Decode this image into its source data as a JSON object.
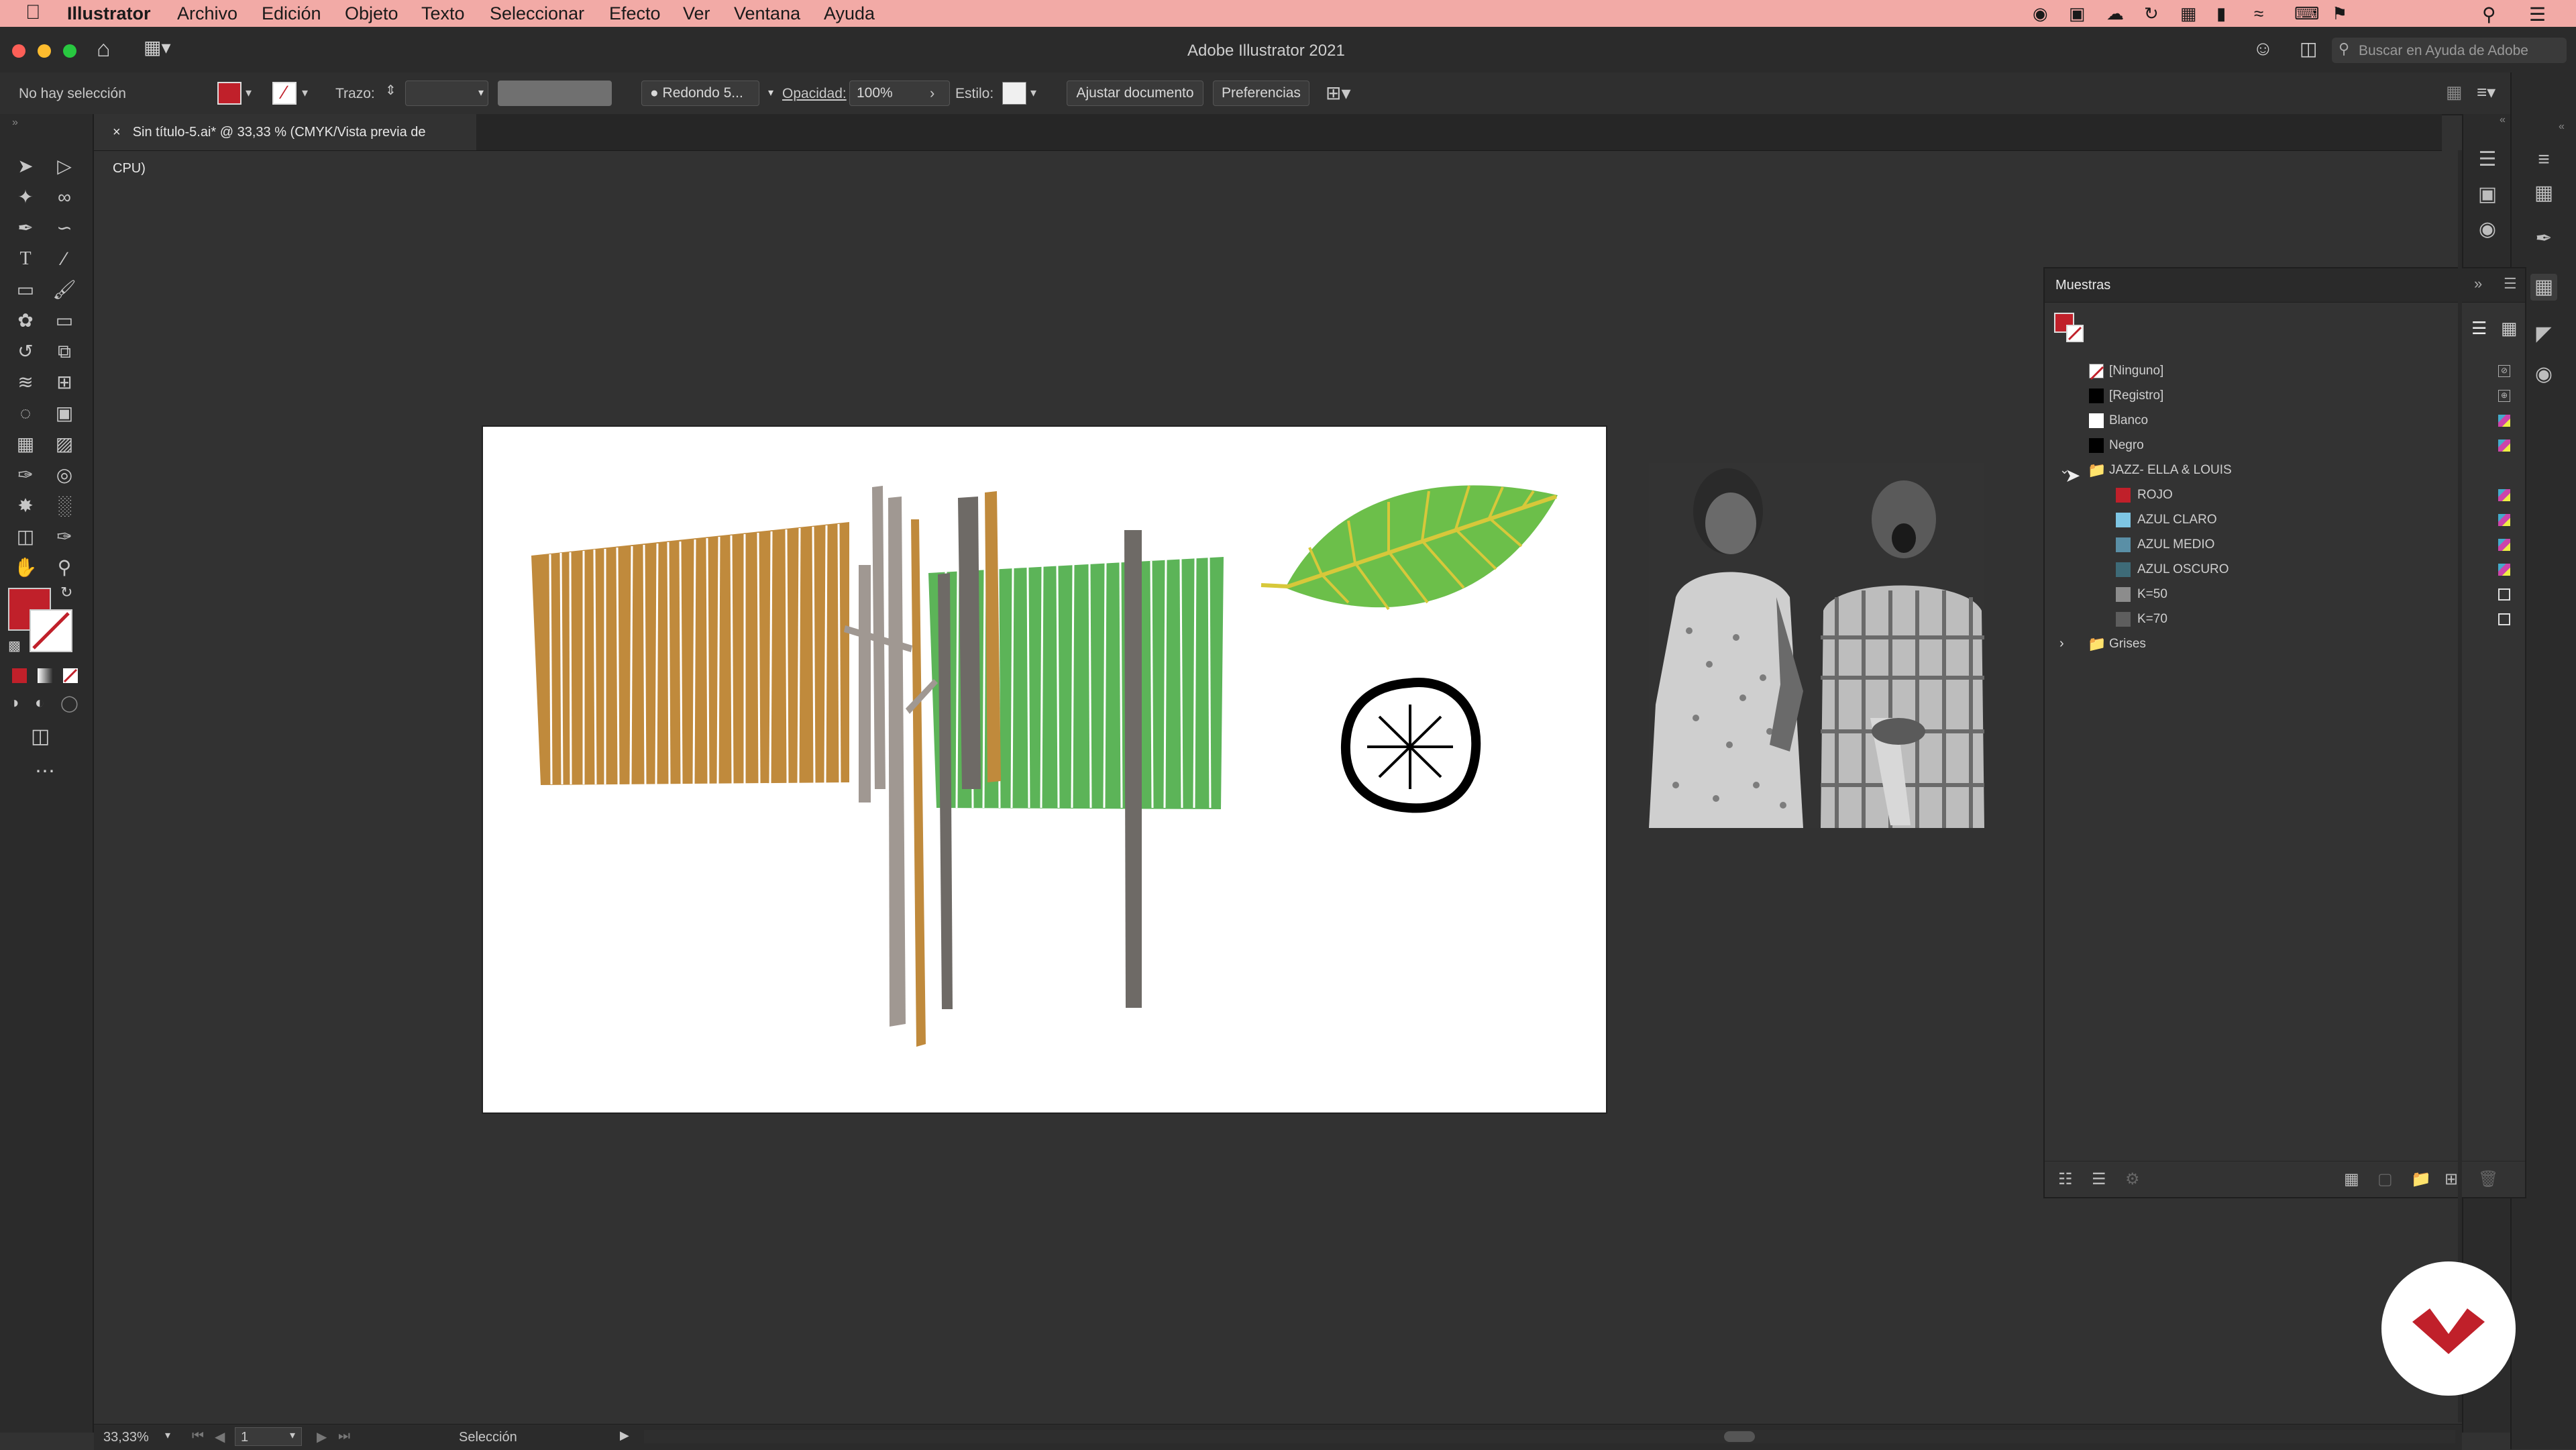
{
  "menubar": {
    "app_name": "Illustrator",
    "items": [
      "Archivo",
      "Edición",
      "Objeto",
      "Texto",
      "Seleccionar",
      "Efecto",
      "Ver",
      "Ventana",
      "Ayuda"
    ]
  },
  "titlebar": {
    "title": "Adobe Illustrator 2021",
    "search_placeholder": "Buscar en Ayuda de Adobe"
  },
  "controlbar": {
    "selection_status": "No hay selección",
    "stroke_label": "Trazo:",
    "brush_label": "Redondo 5...",
    "opacity_label": "Opacidad:",
    "opacity_value": "100%",
    "style_label": "Estilo:",
    "fit_document_button": "Ajustar documento",
    "preferences_button": "Preferencias"
  },
  "document_tab": {
    "label": "Sin título-5.ai* @ 33,33 % (CMYK/Vista previa de CPU)",
    "close_glyph": "×"
  },
  "swatches_panel": {
    "title": "Muestras",
    "rows": [
      {
        "label": "[Ninguno]",
        "color": "none",
        "indent": false
      },
      {
        "label": "[Registro]",
        "color": "#000000",
        "indent": false
      },
      {
        "label": "Blanco",
        "color": "#ffffff",
        "indent": false
      },
      {
        "label": "Negro",
        "color": "#000000",
        "indent": false
      },
      {
        "label": "JAZZ- ELLA & LOUIS",
        "color": "folder",
        "indent": false
      },
      {
        "label": "ROJO",
        "color": "#c0202a",
        "indent": true
      },
      {
        "label": "AZUL CLARO",
        "color": "#7ec6e4",
        "indent": true
      },
      {
        "label": "AZUL MEDIO",
        "color": "#5a8fa6",
        "indent": true
      },
      {
        "label": "AZUL OSCURO",
        "color": "#3e6b78",
        "indent": true
      },
      {
        "label": "K=50",
        "color": "#8c8c8c",
        "indent": true
      },
      {
        "label": "K=70",
        "color": "#5e5e5e",
        "indent": true
      },
      {
        "label": "Grises",
        "color": "folder",
        "indent": false
      }
    ]
  },
  "statusbar": {
    "zoom": "33,33%",
    "artboard_number": "1",
    "tool_name": "Selección"
  },
  "colors": {
    "fill": "#c0202a",
    "menubar_bg": "#f2aaa6",
    "canvas_bg": "#323232",
    "ochre": "#c08a3c",
    "green": "#5cb458",
    "grey_bar": "#a09892",
    "dark_grey_bar": "#6e6a66",
    "leaf_green": "#6cbf4a",
    "leaf_vein": "#d7c83a"
  }
}
